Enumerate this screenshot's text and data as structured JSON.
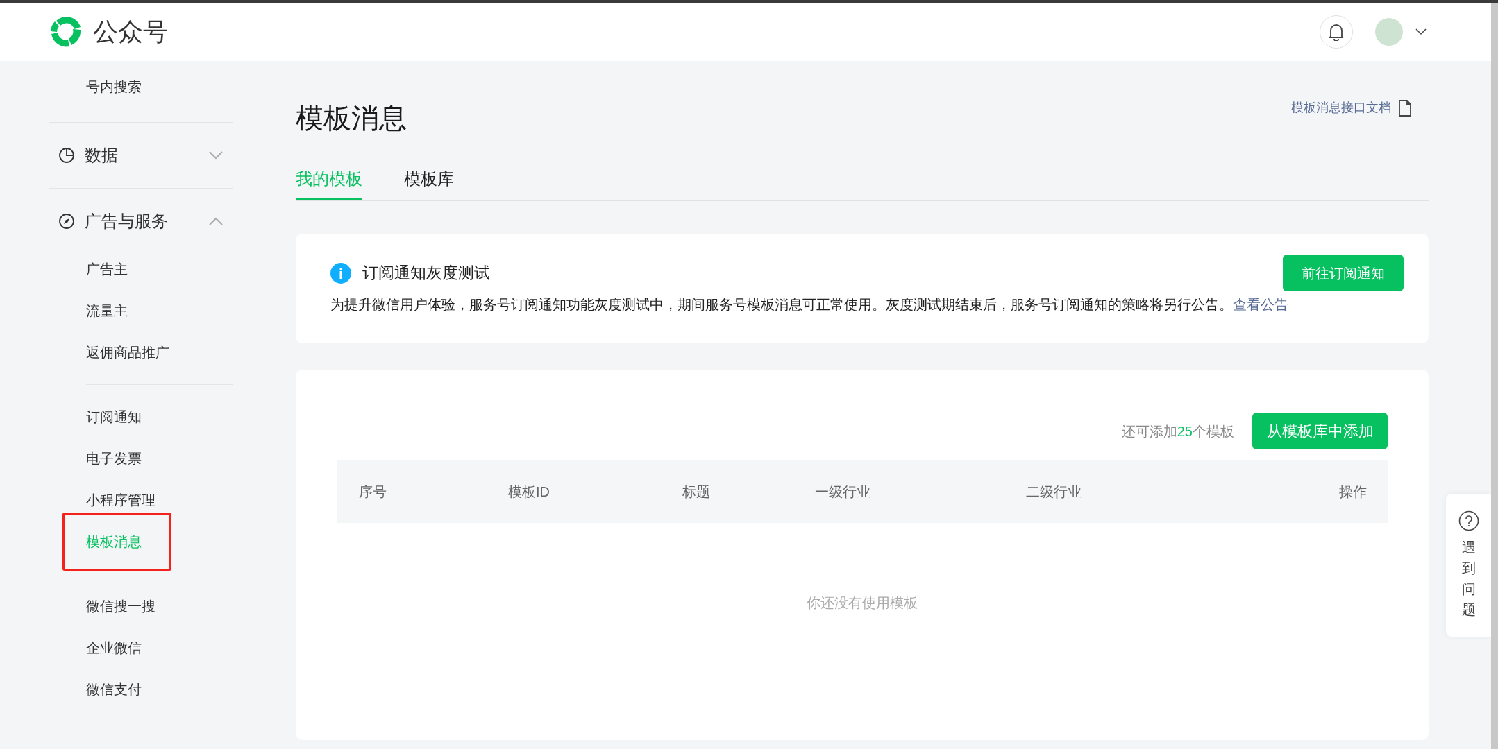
{
  "header": {
    "brand": "公众号"
  },
  "sidebar": {
    "items": [
      {
        "kind": "item",
        "label": "号内搜索",
        "selected": false
      },
      {
        "kind": "group",
        "label": "数据",
        "expanded": false
      },
      {
        "kind": "group",
        "label": "广告与服务",
        "expanded": true,
        "children": [
          {
            "kind": "item",
            "label": "广告主",
            "selected": false,
            "outlined": false
          },
          {
            "kind": "item",
            "label": "流量主",
            "selected": false,
            "outlined": false
          },
          {
            "kind": "item",
            "label": "返佣商品推广",
            "selected": false,
            "outlined": false
          },
          {
            "kind": "separator"
          },
          {
            "kind": "item",
            "label": "订阅通知",
            "selected": false,
            "outlined": false
          },
          {
            "kind": "item",
            "label": "电子发票",
            "selected": false,
            "outlined": false
          },
          {
            "kind": "item",
            "label": "小程序管理",
            "selected": false,
            "outlined": false
          },
          {
            "kind": "item",
            "label": "模板消息",
            "selected": true,
            "outlined": true
          },
          {
            "kind": "separator"
          },
          {
            "kind": "item",
            "label": "微信搜一搜",
            "selected": false,
            "outlined": false
          },
          {
            "kind": "item",
            "label": "企业微信",
            "selected": false,
            "outlined": false
          },
          {
            "kind": "item",
            "label": "微信支付",
            "selected": false,
            "outlined": false
          }
        ]
      }
    ]
  },
  "page": {
    "title": "模板消息",
    "doc_link": "模板消息接口文档"
  },
  "tabs": [
    {
      "label": "我的模板",
      "selected": true
    },
    {
      "label": "模板库",
      "selected": false
    }
  ],
  "notice": {
    "title": "订阅通知灰度测试",
    "text": "为提升微信用户体验，服务号订阅通知功能灰度测试中，期间服务号模板消息可正常使用。灰度测试期结束后，服务号订阅通知的策略将另行公告。",
    "link": "查看公告",
    "button": "前往订阅通知"
  },
  "templates": {
    "quota": {
      "before": "还可添加",
      "count": "25",
      "after": "个模板"
    },
    "add_button": "从模板库中添加",
    "columns": [
      "序号",
      "模板ID",
      "标题",
      "一级行业",
      "二级行业",
      "操作"
    ],
    "empty_text": "你还没有使用模板"
  },
  "help": {
    "label": "遇到问题"
  }
}
